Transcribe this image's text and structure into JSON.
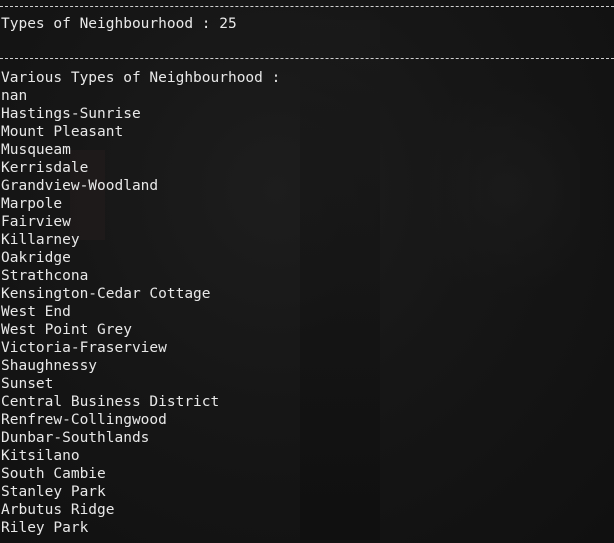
{
  "terminal": {
    "header": {
      "label": "Types of Neighbourhood : 25"
    },
    "list_heading": "Various Types of Neighbourhood :",
    "neighbourhoods": [
      "nan",
      "Hastings-Sunrise",
      "Mount Pleasant",
      "Musqueam",
      "Kerrisdale",
      "Grandview-Woodland",
      "Marpole",
      "Fairview",
      "Killarney",
      "Oakridge",
      "Strathcona",
      "Kensington-Cedar Cottage",
      "West End",
      "West Point Grey",
      "Victoria-Fraserview",
      "Shaughnessy",
      "Sunset",
      "Central Business District",
      "Renfrew-Collingwood",
      "Dunbar-Southlands",
      "Kitsilano",
      "South Cambie",
      "Stanley Park",
      "Arbutus Ridge",
      "Riley Park"
    ],
    "colors": {
      "background": "#121212",
      "text": "#e8e8e8",
      "rule": "#cfcfcf"
    }
  }
}
